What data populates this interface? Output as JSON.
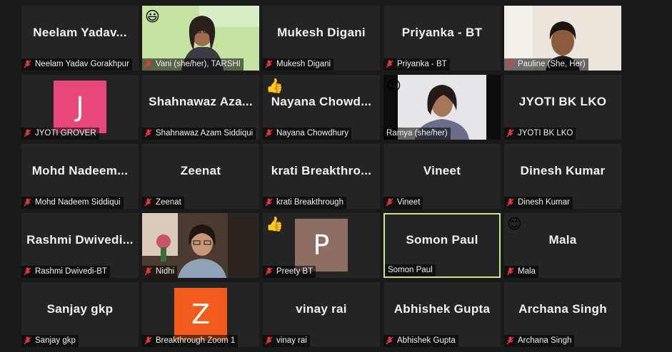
{
  "colors": {
    "avatar_pink": "#e8477a",
    "avatar_orange": "#f25b1c",
    "avatar_taupe": "#8d6e63",
    "active_border": "#c9e88a"
  },
  "participants": [
    {
      "name_big": "Neelam  Yadav...",
      "label": "Neelam Yadav Gorakhpur"
    },
    {
      "label": "Vani (she/her), TARSHI",
      "emoji": "😃",
      "video": "green"
    },
    {
      "name_big": "Mukesh Digani",
      "label": "Mukesh Digani"
    },
    {
      "name_big": "Priyanka - BT",
      "label": "Priyanka - BT"
    },
    {
      "label": "Pauline (She, Her)",
      "video": "beige"
    },
    {
      "avatar_letter": "J",
      "label": "JYOTI GROVER"
    },
    {
      "name_big": "Shahnawaz  Aza...",
      "label": "Shahnawaz Azam Siddiqui"
    },
    {
      "name_big": "Nayana  Chowd...",
      "label": "Nayana Chowdhury",
      "emoji": "👍"
    },
    {
      "label": "Ramya (she/her)",
      "emoji": "😍",
      "video": "white"
    },
    {
      "name_big": "JYOTI BK LKO",
      "label": "JYOTI BK LKO"
    },
    {
      "name_big": "Mohd  Nadeem...",
      "label": "Mohd Nadeem Siddiqui"
    },
    {
      "name_big": "Zeenat",
      "label": "Zeenat"
    },
    {
      "name_big": "krati  Breakthro...",
      "label": "krati Breakthrough"
    },
    {
      "name_big": "Vineet",
      "label": "Vineet"
    },
    {
      "name_big": "Dinesh Kumar",
      "label": "Dinesh Kumar"
    },
    {
      "name_big": "Rashmi  Dwivedi...",
      "label": "Rashmi Dwivedi-BT"
    },
    {
      "label": "Nidhi",
      "video": "room"
    },
    {
      "avatar_letter": "P",
      "label": "Preety BT",
      "emoji": "👍"
    },
    {
      "name_big": "Somon Paul",
      "label": "Somon Paul",
      "active": true
    },
    {
      "name_big": "Mala",
      "label": "Mala",
      "emoji": "😊"
    },
    {
      "name_big": "Sanjay gkp",
      "label": "Sanjay gkp"
    },
    {
      "avatar_letter": "Z",
      "label": "Breakthrough Zoom 1"
    },
    {
      "name_big": "vinay rai",
      "label": "vinay rai"
    },
    {
      "name_big": "Abhishek Gupta",
      "label": "Abhishek Gupta"
    },
    {
      "name_big": "Archana Singh",
      "label": "Archana Singh"
    }
  ]
}
